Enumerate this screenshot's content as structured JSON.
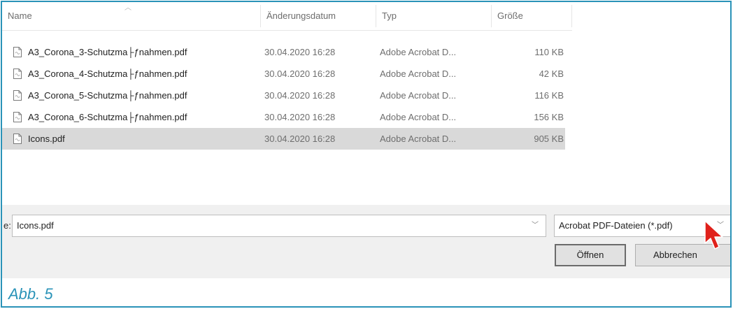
{
  "columns": {
    "name": "Name",
    "date": "Änderungsdatum",
    "type": "Typ",
    "size": "Größe"
  },
  "files": [
    {
      "name": "A3_Corona_3-Schutzma├ƒnahmen.pdf",
      "date": "30.04.2020 16:28",
      "type": "Adobe Acrobat D...",
      "size": "110 KB",
      "selected": false
    },
    {
      "name": "A3_Corona_4-Schutzma├ƒnahmen.pdf",
      "date": "30.04.2020 16:28",
      "type": "Adobe Acrobat D...",
      "size": "42 KB",
      "selected": false
    },
    {
      "name": "A3_Corona_5-Schutzma├ƒnahmen.pdf",
      "date": "30.04.2020 16:28",
      "type": "Adobe Acrobat D...",
      "size": "116 KB",
      "selected": false
    },
    {
      "name": "A3_Corona_6-Schutzma├ƒnahmen.pdf",
      "date": "30.04.2020 16:28",
      "type": "Adobe Acrobat D...",
      "size": "156 KB",
      "selected": false
    },
    {
      "name": "Icons.pdf",
      "date": "30.04.2020 16:28",
      "type": "Adobe Acrobat D...",
      "size": "905 KB",
      "selected": true
    }
  ],
  "filename": {
    "label": "e:",
    "value": "Icons.pdf"
  },
  "filetype": {
    "value": "Acrobat PDF-Dateien (*.pdf)"
  },
  "buttons": {
    "open": "Öffnen",
    "cancel": "Abbrechen"
  },
  "caption": "Abb. 5",
  "colors": {
    "frame": "#2a93b8",
    "caption": "#2a93b8",
    "cursor": "#e0211b",
    "selected_row": "#d9d9d9"
  },
  "icons": {
    "file": "pdf-file-icon",
    "cursor": "mouse-pointer-icon",
    "dropdown": "chevron-down-icon"
  }
}
